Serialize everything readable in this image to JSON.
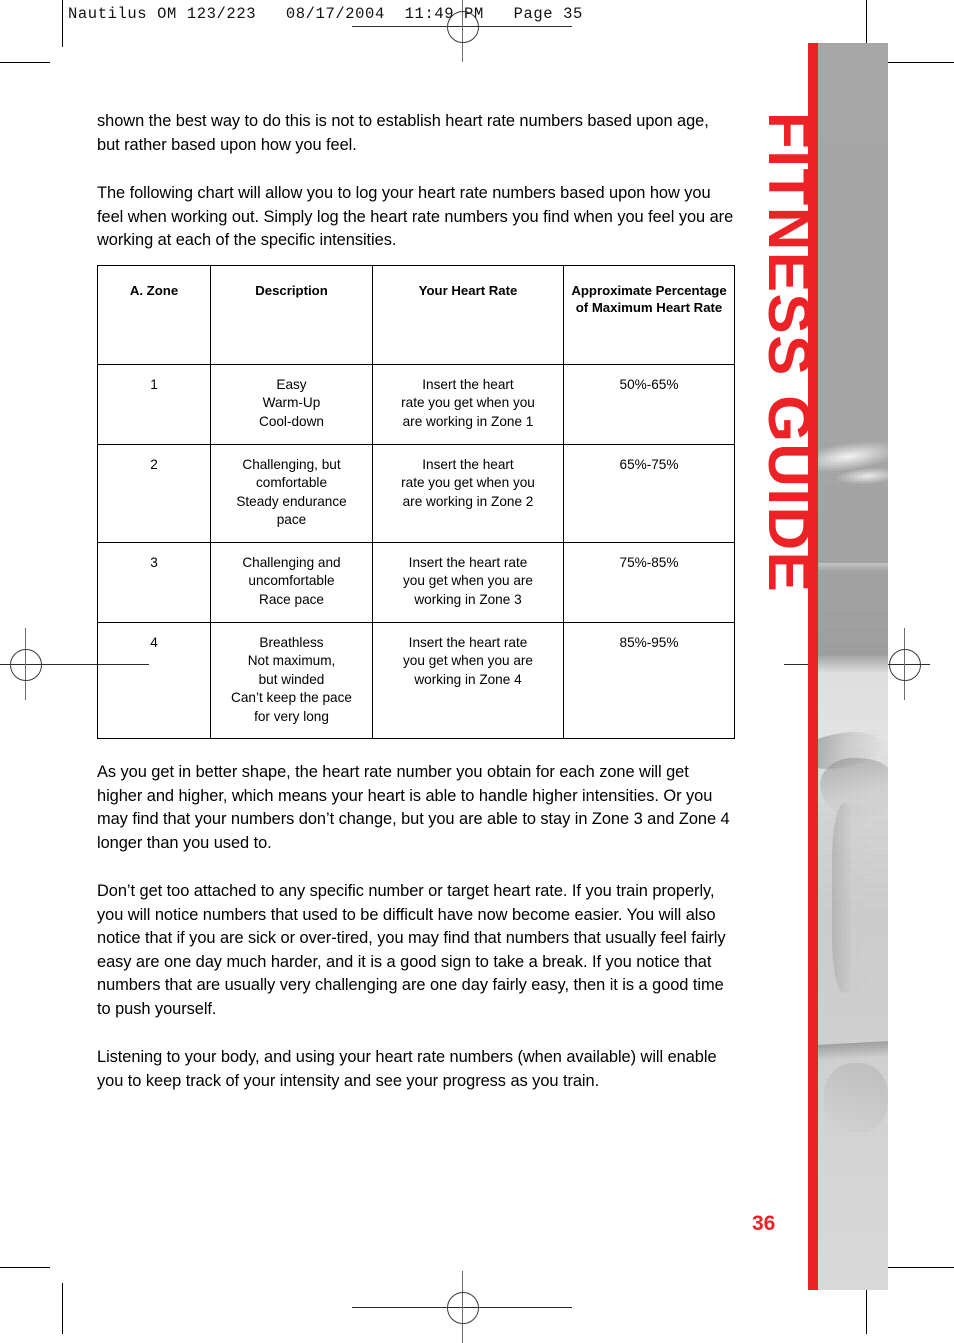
{
  "print_header": "Nautilus OM 123/223   08/17/2004  11:49 PM   Page 35",
  "sidebar": {
    "title": "FITNESS GUIDE",
    "page_number": "36",
    "accent_color": "#ec2227"
  },
  "content": {
    "paragraph_1": "shown the best way to do this is not to establish heart rate numbers based upon age, but rather based upon how you feel.",
    "paragraph_2": "The following chart will allow you to log your heart rate numbers based upon how you feel when working out. Simply log the heart rate numbers you find when you feel you are working at each of the specific intensities.",
    "paragraph_3": "As you get in better shape, the heart rate number you obtain for each zone will get higher and higher, which means your heart is able to handle higher intensities. Or you may find that your numbers don’t change, but you are able to stay in Zone 3 and Zone 4 longer than you used to.",
    "paragraph_4": "Don’t get too attached to any specific number or target heart rate. If you train properly, you will notice numbers that used to be difficult have now become easier. You will also notice that if you are sick or over-tired, you may find that numbers that usually feel fairly easy are one day much harder, and it is a good sign to take a break. If you notice that numbers that are usually very challenging are one day fairly easy, then it is a good time to push yourself.",
    "paragraph_5": "Listening to your body, and using your heart rate numbers (when available) will enable you to keep track of your intensity and see your progress as you train."
  },
  "table": {
    "headers": {
      "zone": "A. Zone",
      "description": "Description",
      "heart_rate": "Your Heart Rate",
      "percentage": "Approximate Percentage of Maximum Heart Rate"
    },
    "rows": [
      {
        "zone": "1",
        "description": "Easy\nWarm-Up\nCool-down",
        "heart_rate": "Insert the heart\nrate you get when you\nare working in Zone 1",
        "percentage": "50%-65%"
      },
      {
        "zone": "2",
        "description": "Challenging, but\ncomfortable\nSteady endurance\npace",
        "heart_rate": "Insert the heart\nrate you get when you\nare working in Zone 2",
        "percentage": "65%-75%"
      },
      {
        "zone": "3",
        "description": "Challenging and\nuncomfortable\nRace pace",
        "heart_rate": "Insert the heart rate\nyou get when you are\nworking in Zone 3",
        "percentage": "75%-85%"
      },
      {
        "zone": "4",
        "description": "Breathless\nNot maximum,\nbut winded\nCan’t keep the pace\nfor very long",
        "heart_rate": "Insert the heart rate\nyou get when you are\nworking in Zone 4",
        "percentage": "85%-95%"
      }
    ]
  }
}
